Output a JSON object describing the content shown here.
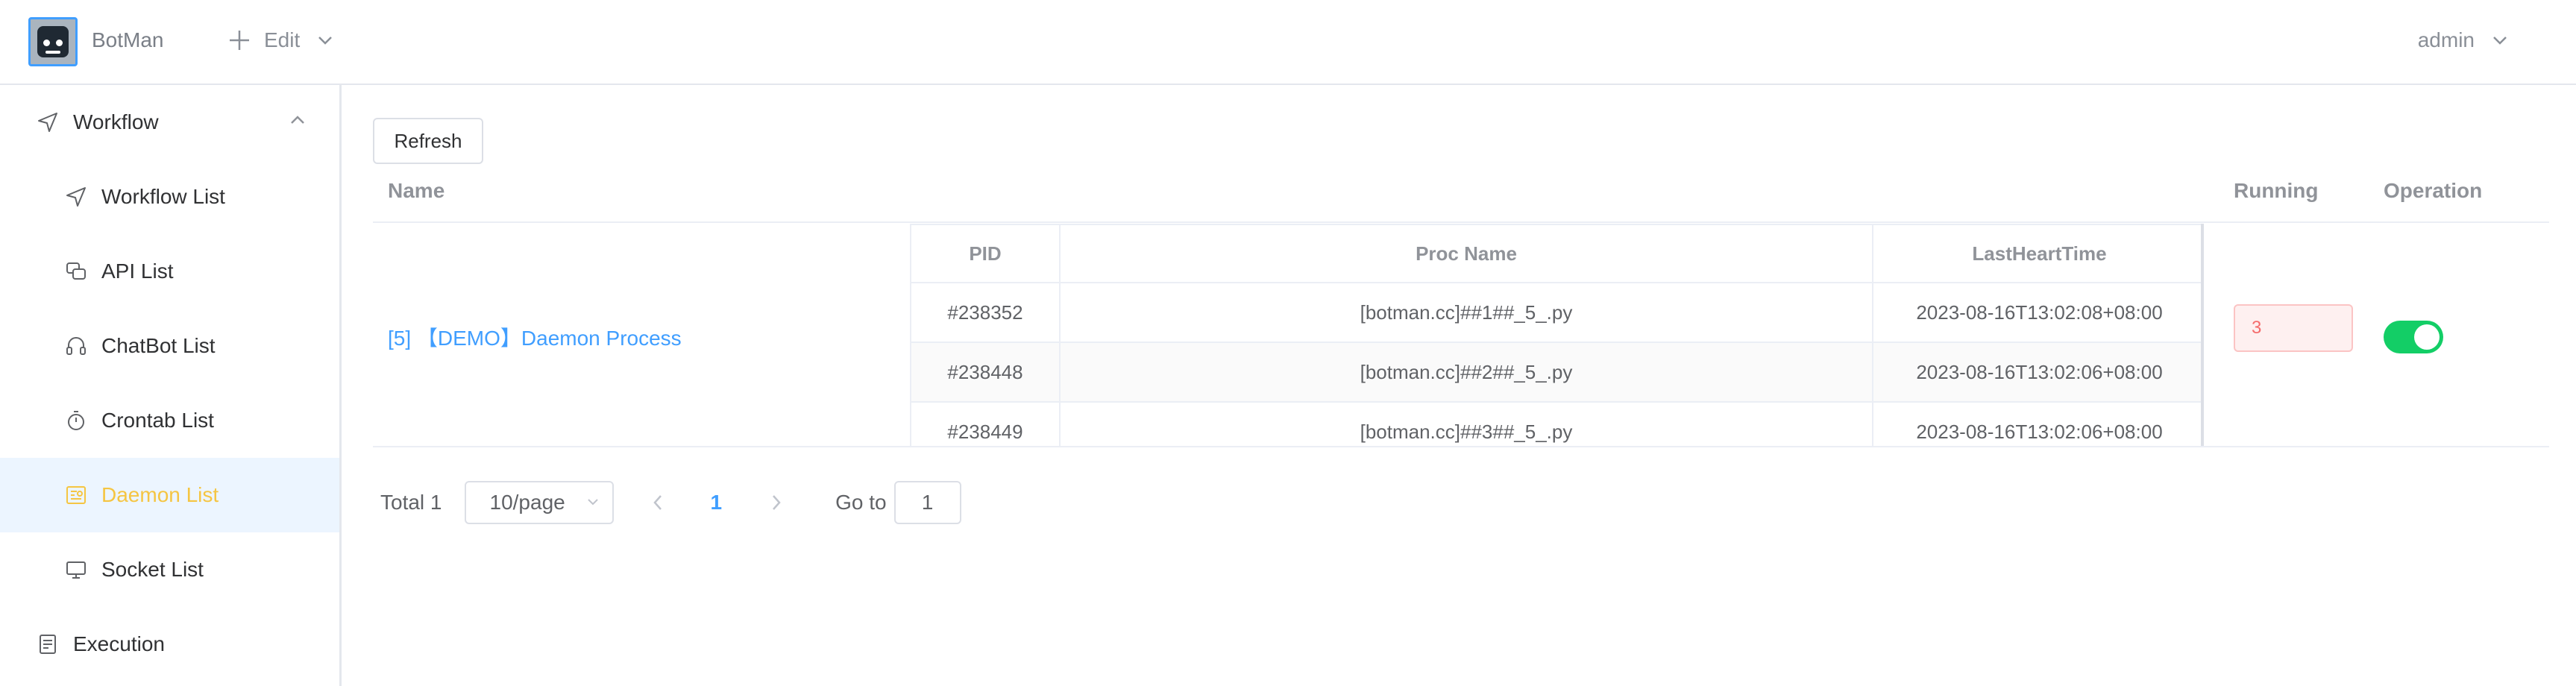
{
  "header": {
    "brand": "BotMan",
    "edit_label": "Edit",
    "user_label": "admin"
  },
  "sidebar": {
    "group_workflow": "Workflow",
    "items": [
      {
        "label": "Workflow List",
        "icon": "navigation-icon"
      },
      {
        "label": "API List",
        "icon": "api-icon"
      },
      {
        "label": "ChatBot List",
        "icon": "headset-icon"
      },
      {
        "label": "Crontab List",
        "icon": "stopwatch-icon"
      },
      {
        "label": "Daemon List",
        "icon": "daemon-icon"
      },
      {
        "label": "Socket List",
        "icon": "monitor-icon"
      }
    ],
    "group_execution": "Execution",
    "active_color": "#f5c542"
  },
  "toolbar": {
    "refresh_label": "Refresh"
  },
  "table": {
    "columns": {
      "name": "Name",
      "running": "Running",
      "operation": "Operation"
    },
    "row": {
      "name": "[5] 【DEMO】Daemon Process",
      "running": "3",
      "enabled": true
    },
    "inner": {
      "headers": [
        "PID",
        "Proc Name",
        "LastHeartTime"
      ],
      "rows": [
        {
          "pid": "#238352",
          "proc_name": "[botman.cc]##1##_5_.py",
          "last_heart_time": "2023-08-16T13:02:08+08:00"
        },
        {
          "pid": "#238448",
          "proc_name": "[botman.cc]##2##_5_.py",
          "last_heart_time": "2023-08-16T13:02:06+08:00"
        },
        {
          "pid": "#238449",
          "proc_name": "[botman.cc]##3##_5_.py",
          "last_heart_time": "2023-08-16T13:02:06+08:00"
        }
      ]
    }
  },
  "pagination": {
    "total": "Total 1",
    "page_size": "10/page",
    "current_page": "1",
    "goto_label": "Go to",
    "goto_value": "1"
  },
  "colors": {
    "primary": "#409eff",
    "switch_on": "#13ce66",
    "danger": "#f56c6c"
  }
}
